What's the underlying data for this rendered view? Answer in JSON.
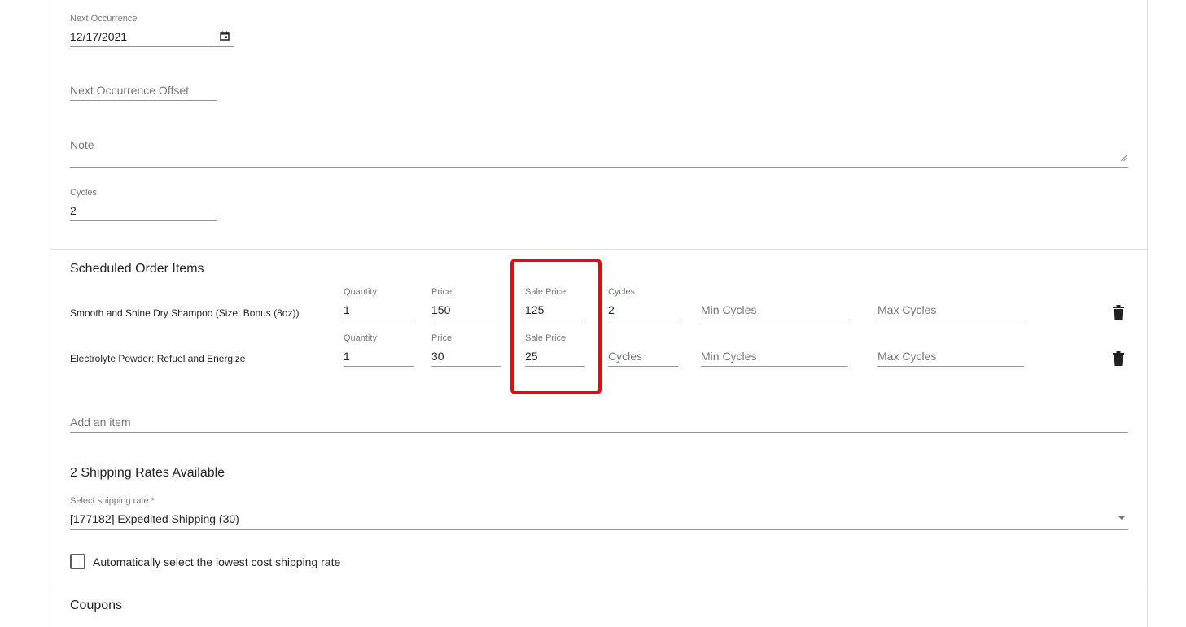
{
  "form": {
    "next_occurrence": {
      "label": "Next Occurrence",
      "value": "12/17/2021"
    },
    "next_occurrence_offset": {
      "placeholder": "Next Occurrence Offset"
    },
    "note": {
      "placeholder": "Note"
    },
    "cycles": {
      "label": "Cycles",
      "value": "2"
    }
  },
  "scheduled_items": {
    "title": "Scheduled Order Items",
    "rows": [
      {
        "name": "Smooth and Shine Dry Shampoo (Size: Bonus (8oz))",
        "quantity_label": "Quantity",
        "quantity": "1",
        "price_label": "Price",
        "price": "150",
        "sale_price_label": "Sale Price",
        "sale_price": "125",
        "cycles_label": "Cycles",
        "cycles": "2",
        "min_cycles_placeholder": "Min Cycles",
        "max_cycles_placeholder": "Max Cycles"
      },
      {
        "name": "Electrolyte Powder: Refuel and Energize",
        "quantity_label": "Quantity",
        "quantity": "1",
        "price_label": "Price",
        "price": "30",
        "sale_price_label": "Sale Price",
        "sale_price": "25",
        "cycles_placeholder": "Cycles",
        "min_cycles_placeholder": "Min Cycles",
        "max_cycles_placeholder": "Max Cycles"
      }
    ],
    "add_item_placeholder": "Add an item"
  },
  "shipping": {
    "title": "2 Shipping Rates Available",
    "select_label": "Select shipping rate *",
    "select_value": "[177182] Expedited Shipping (30)",
    "auto_select_label": "Automatically select the lowest cost shipping rate"
  },
  "coupons": {
    "title": "Coupons"
  },
  "colors": {
    "highlight": "#ff0000",
    "divider": "#e0e0e0",
    "icon": "#212121"
  }
}
